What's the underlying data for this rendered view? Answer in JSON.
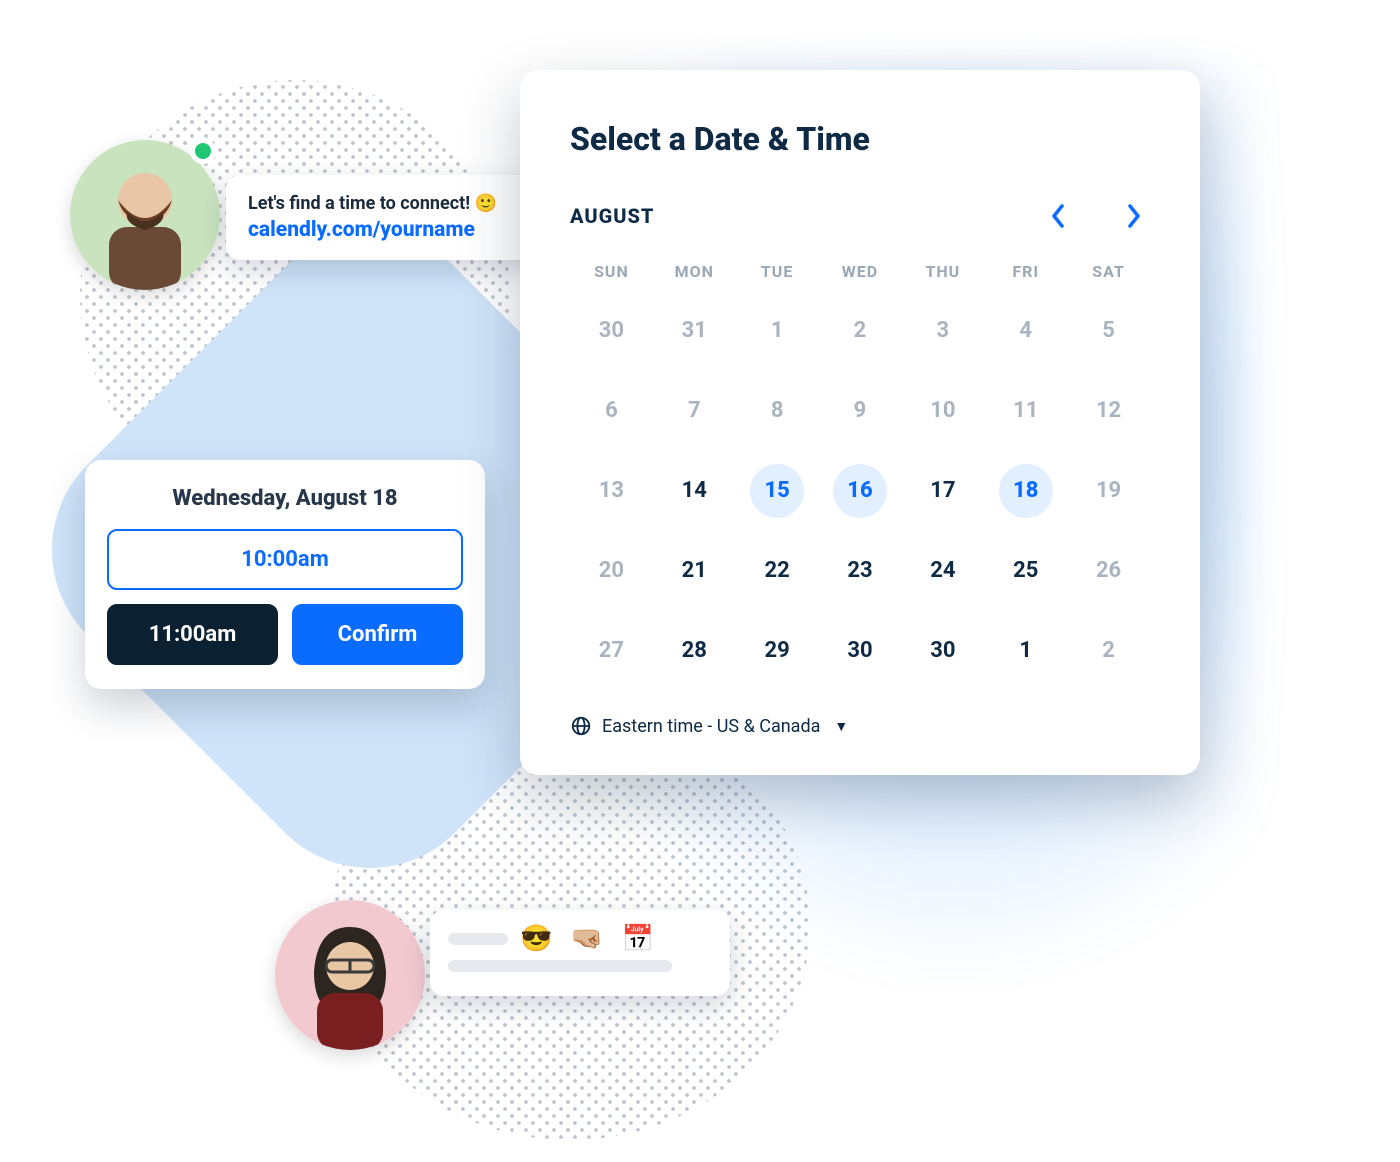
{
  "chat_top": {
    "line1": "Let's find a time to connect!",
    "emoji": "🙂",
    "link_text": "calendly.com/yourname"
  },
  "chat_bottom": {
    "emojis": "😎 🤜🏼 📅"
  },
  "time_picker": {
    "date_title": "Wednesday, August 18",
    "slot_a": "10:00am",
    "slot_b": "11:00am",
    "confirm_label": "Confirm"
  },
  "calendar": {
    "title": "Select a Date & Time",
    "month_label": "AUGUST",
    "dow": [
      "SUN",
      "MON",
      "TUE",
      "WED",
      "THU",
      "FRI",
      "SAT"
    ],
    "weeks": [
      [
        {
          "n": "30",
          "cls": "muted"
        },
        {
          "n": "31",
          "cls": "muted"
        },
        {
          "n": "1",
          "cls": "muted"
        },
        {
          "n": "2",
          "cls": "muted"
        },
        {
          "n": "3",
          "cls": "muted"
        },
        {
          "n": "4",
          "cls": "muted"
        },
        {
          "n": "5",
          "cls": "muted"
        }
      ],
      [
        {
          "n": "6",
          "cls": "muted"
        },
        {
          "n": "7",
          "cls": "muted"
        },
        {
          "n": "8",
          "cls": "muted"
        },
        {
          "n": "9",
          "cls": "muted"
        },
        {
          "n": "10",
          "cls": "muted"
        },
        {
          "n": "11",
          "cls": "muted"
        },
        {
          "n": "12",
          "cls": "muted"
        }
      ],
      [
        {
          "n": "13",
          "cls": "muted"
        },
        {
          "n": "14",
          "cls": "normal"
        },
        {
          "n": "15",
          "cls": "avail bold"
        },
        {
          "n": "16",
          "cls": "avail bold"
        },
        {
          "n": "17",
          "cls": "normal"
        },
        {
          "n": "18",
          "cls": "avail bold"
        },
        {
          "n": "19",
          "cls": "muted"
        }
      ],
      [
        {
          "n": "20",
          "cls": "muted"
        },
        {
          "n": "21",
          "cls": "normal"
        },
        {
          "n": "22",
          "cls": "normal"
        },
        {
          "n": "23",
          "cls": "normal"
        },
        {
          "n": "24",
          "cls": "normal"
        },
        {
          "n": "25",
          "cls": "normal"
        },
        {
          "n": "26",
          "cls": "muted"
        }
      ],
      [
        {
          "n": "27",
          "cls": "muted"
        },
        {
          "n": "28",
          "cls": "normal"
        },
        {
          "n": "29",
          "cls": "normal"
        },
        {
          "n": "30",
          "cls": "normal"
        },
        {
          "n": "30",
          "cls": "normal"
        },
        {
          "n": "1",
          "cls": "normal"
        },
        {
          "n": "2",
          "cls": "muted"
        }
      ]
    ],
    "timezone_label": "Eastern time - US & Canada"
  },
  "colors": {
    "accent": "#0a6cff",
    "dark": "#0b2031",
    "text": "#0e2a45",
    "avail_bg": "#e2efff",
    "presence": "#1ec773"
  }
}
